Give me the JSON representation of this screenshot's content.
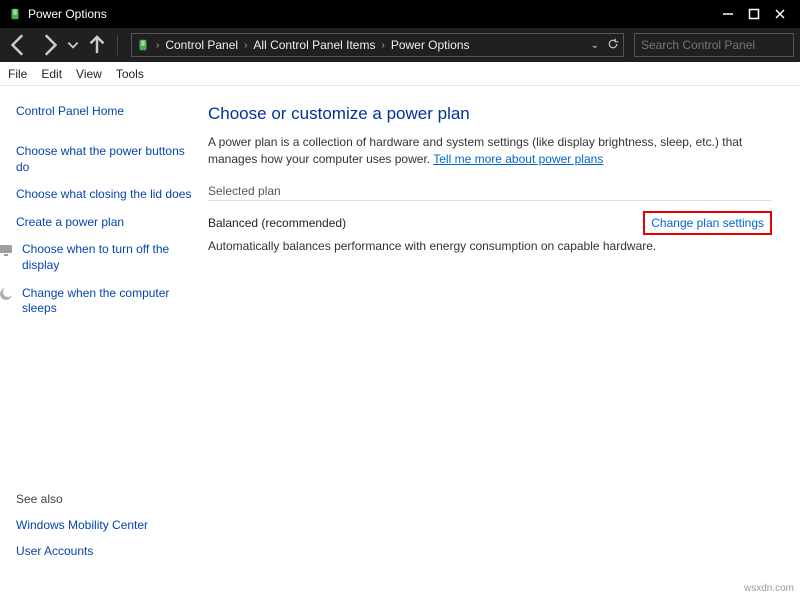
{
  "titlebar": {
    "title": "Power Options"
  },
  "breadcrumb": {
    "items": [
      "Control Panel",
      "All Control Panel Items",
      "Power Options"
    ]
  },
  "search": {
    "placeholder": "Search Control Panel"
  },
  "menu": {
    "items": [
      "File",
      "Edit",
      "View",
      "Tools"
    ]
  },
  "sidebar": {
    "home": "Control Panel Home",
    "links": [
      {
        "label": "Choose what the power buttons do"
      },
      {
        "label": "Choose what closing the lid does"
      },
      {
        "label": "Create a power plan"
      },
      {
        "label": "Choose when to turn off the display"
      },
      {
        "label": "Change when the computer sleeps"
      }
    ],
    "seealso": {
      "title": "See also",
      "items": [
        "Windows Mobility Center",
        "User Accounts"
      ]
    }
  },
  "main": {
    "heading": "Choose or customize a power plan",
    "desc_pre": "A power plan is a collection of hardware and system settings (like display brightness, sleep, etc.) that manages how your computer uses power. ",
    "desc_link": "Tell me more about power plans",
    "section": "Selected plan",
    "plan_name": "Balanced (recommended)",
    "change_link": "Change plan settings",
    "plan_desc": "Automatically balances performance with energy consumption on capable hardware."
  },
  "watermark": "wsxdn.com"
}
